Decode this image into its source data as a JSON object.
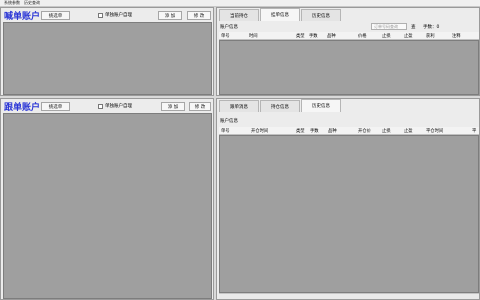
{
  "menu": [
    "系统参数",
    "历史查询"
  ],
  "top_left": {
    "title": "喊单账户",
    "select_btn": "挑选单",
    "checkbox_label": "单独账户自理",
    "add_btn": "添 加",
    "edit_btn": "修 改"
  },
  "top_right": {
    "tabs": [
      "当前持仓",
      "挂单信息",
      "历史信息"
    ],
    "active_tab": 1,
    "section_label": "账户信息",
    "input_placeholder": "订单号码查询",
    "input_suffix": "查",
    "count_label": "手数：0",
    "columns": [
      "单号",
      "时间",
      "类型",
      "手数",
      "品种",
      "价格",
      "止损",
      "止盈",
      "获利",
      "注释"
    ]
  },
  "bottom_left": {
    "title": "跟单账户",
    "select_btn": "挑选单",
    "checkbox_label": "单独账户自理",
    "add_btn": "添 加",
    "edit_btn": "修 改"
  },
  "bottom_right": {
    "tabs": [
      "跟单消息",
      "持仓信息",
      "历史信息"
    ],
    "active_tab": 2,
    "section_label": "账户信息",
    "columns": [
      "单号",
      "开仓时间",
      "类型",
      "手数",
      "品种",
      "开仓价",
      "止损",
      "止盈",
      "平仓时间",
      "平"
    ]
  }
}
